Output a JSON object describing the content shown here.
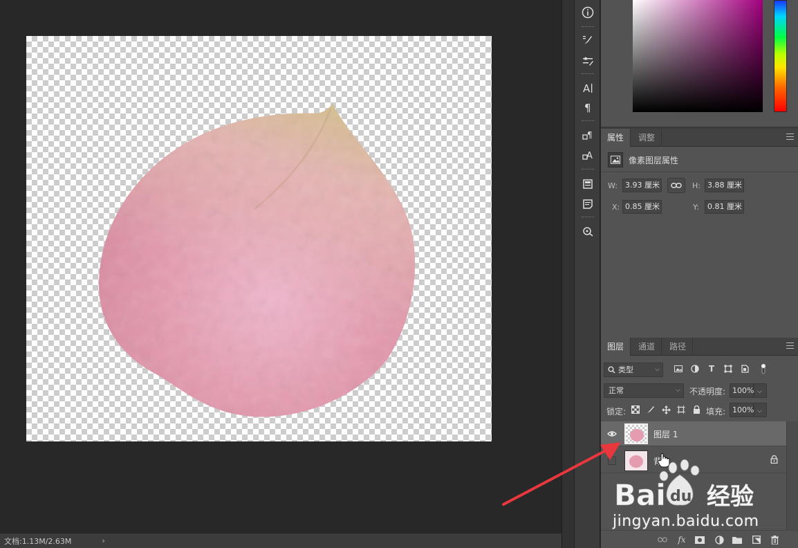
{
  "status_bar": {
    "doc_info": "文档:1.13M/2.63M",
    "arrow": "›"
  },
  "toolstrip": {
    "icons": [
      "info-icon",
      "brush-presets-icon",
      "brush-settings-icon",
      "character-icon",
      "paragraph-icon",
      "paragraph-styles-icon",
      "character-styles-icon",
      "history-icon",
      "notes-icon",
      "3d-icon"
    ]
  },
  "properties": {
    "tabs": [
      "属性",
      "调整"
    ],
    "header": "像素图层属性",
    "w_label": "W:",
    "w_value": "3.93 厘米",
    "h_label": "H:",
    "h_value": "3.88 厘米",
    "x_label": "X:",
    "x_value": "0.85 厘米",
    "y_label": "Y:",
    "y_value": "0.81 厘米"
  },
  "layers": {
    "tabs": [
      "图层",
      "通道",
      "路径"
    ],
    "filter_kind": "类型",
    "blend_mode": "正常",
    "opacity_label": "不透明度:",
    "opacity_value": "100%",
    "lock_label": "锁定:",
    "fill_label": "填充:",
    "fill_value": "100%",
    "items": [
      {
        "name": "图层 1",
        "visible": true,
        "active": true,
        "locked": false
      },
      {
        "name": "背",
        "visible": false,
        "active": false,
        "locked": true
      }
    ]
  },
  "watermark": {
    "brand": "Bai",
    "brand2": "du",
    "jingyan": "经验",
    "url": "jingyan.baidu.com"
  },
  "colors": {
    "panel_bg": "#535353",
    "canvas_bg": "#282828",
    "arrow": "#e8383d",
    "petal": "#e8a2b6"
  }
}
